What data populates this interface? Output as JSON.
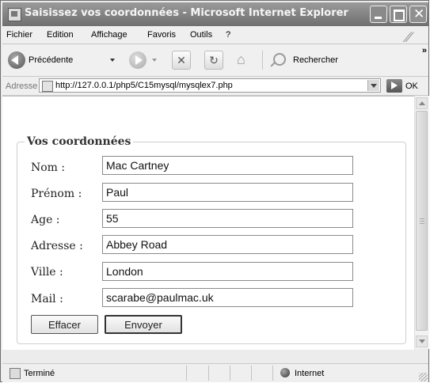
{
  "window": {
    "title": "Saisissez vos coordonnées - Microsoft Internet Explorer"
  },
  "menubar": {
    "items": [
      "Fichier",
      "Edition",
      "Affichage",
      "Favoris",
      "Outils",
      "?"
    ]
  },
  "toolbar": {
    "back_label": "Précédente",
    "search_label": "Rechercher",
    "more_glyph": "»"
  },
  "addressbar": {
    "label": "Adresse",
    "url": "http://127.0.0.1/php5/C15mysql/mysqlex7.php",
    "go_label": "OK"
  },
  "form": {
    "legend": "Vos coordonnées",
    "fields": [
      {
        "label": "Nom :",
        "value": "Mac Cartney"
      },
      {
        "label": "Prénom :",
        "value": "Paul"
      },
      {
        "label": "Age :",
        "value": "55"
      },
      {
        "label": "Adresse :",
        "value": "Abbey Road"
      },
      {
        "label": "Ville :",
        "value": "London"
      },
      {
        "label": "Mail :",
        "value": "scarabe@paulmac.uk"
      }
    ],
    "reset_label": "Effacer",
    "submit_label": "Envoyer"
  },
  "statusbar": {
    "status": "Terminé",
    "zone": "Internet"
  }
}
